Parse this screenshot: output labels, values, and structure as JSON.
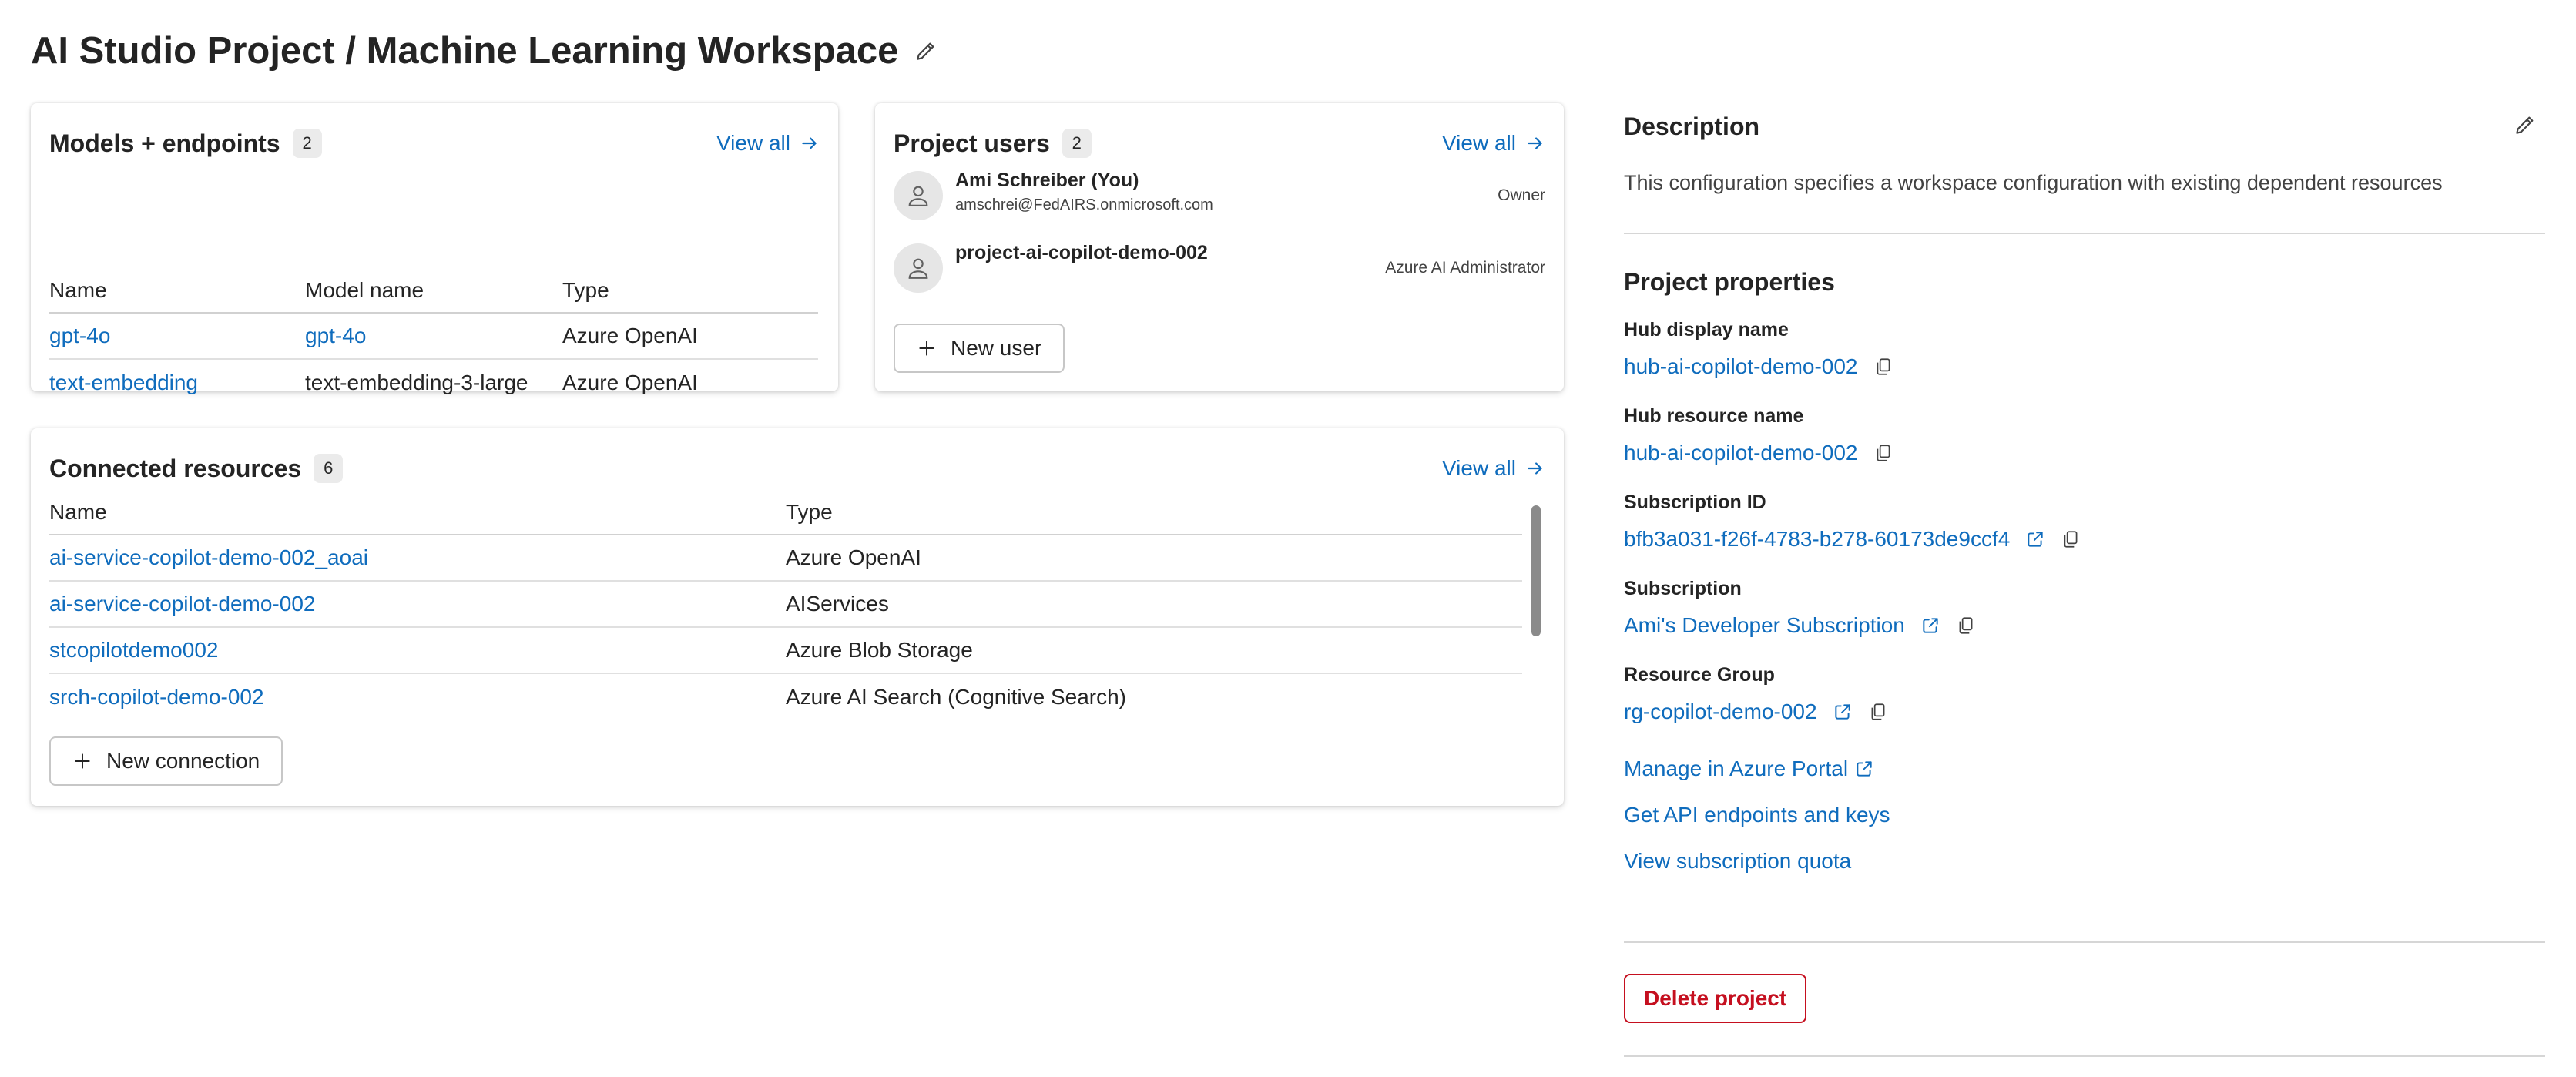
{
  "page": {
    "title": "AI Studio Project / Machine Learning Workspace"
  },
  "models": {
    "title": "Models + endpoints",
    "count": "2",
    "view_all": "View all",
    "columns": [
      "Name",
      "Model name",
      "Type"
    ],
    "rows": [
      {
        "name": "gpt-4o",
        "model": "gpt-4o",
        "type": "Azure OpenAI"
      },
      {
        "name": "text-embedding",
        "model": "text-embedding-3-large",
        "type": "Azure OpenAI"
      }
    ]
  },
  "users": {
    "title": "Project users",
    "count": "2",
    "view_all": "View all",
    "list": [
      {
        "name": "Ami Schreiber (You)",
        "email": "amschrei@FedAIRS.onmicrosoft.com",
        "role": "Owner"
      },
      {
        "name": "project-ai-copilot-demo-002",
        "email": "",
        "role": "Azure AI Administrator"
      }
    ],
    "new_user": "New user"
  },
  "connected": {
    "title": "Connected resources",
    "count": "6",
    "view_all": "View all",
    "columns": [
      "Name",
      "Type"
    ],
    "rows": [
      {
        "name": "ai-service-copilot-demo-002_aoai",
        "type": "Azure OpenAI"
      },
      {
        "name": "ai-service-copilot-demo-002",
        "type": "AIServices"
      },
      {
        "name": "stcopilotdemo002",
        "type": "Azure Blob Storage"
      },
      {
        "name": "srch-copilot-demo-002",
        "type": "Azure AI Search (Cognitive Search)"
      }
    ],
    "new_connection": "New connection"
  },
  "description": {
    "title": "Description",
    "text": "This configuration specifies a workspace configuration with existing dependent resources"
  },
  "properties": {
    "title": "Project properties",
    "hub_display_label": "Hub display name",
    "hub_display_value": "hub-ai-copilot-demo-002",
    "hub_resource_label": "Hub resource name",
    "hub_resource_value": "hub-ai-copilot-demo-002",
    "subscription_id_label": "Subscription ID",
    "subscription_id_value": "bfb3a031-f26f-4783-b278-60173de9ccf4",
    "subscription_label": "Subscription",
    "subscription_value": "Ami's Developer Subscription",
    "resource_group_label": "Resource Group",
    "resource_group_value": "rg-copilot-demo-002"
  },
  "links": {
    "manage": "Manage in Azure Portal",
    "api": "Get API endpoints and keys",
    "quota": "View subscription quota"
  },
  "delete_label": "Delete project",
  "colors": {
    "link": "#0f6cbd",
    "danger": "#c50f1f",
    "text": "#242424"
  },
  "icons": [
    "pencil-icon",
    "arrow-right-icon",
    "person-icon",
    "plus-icon",
    "copy-icon",
    "external-link-icon"
  ]
}
